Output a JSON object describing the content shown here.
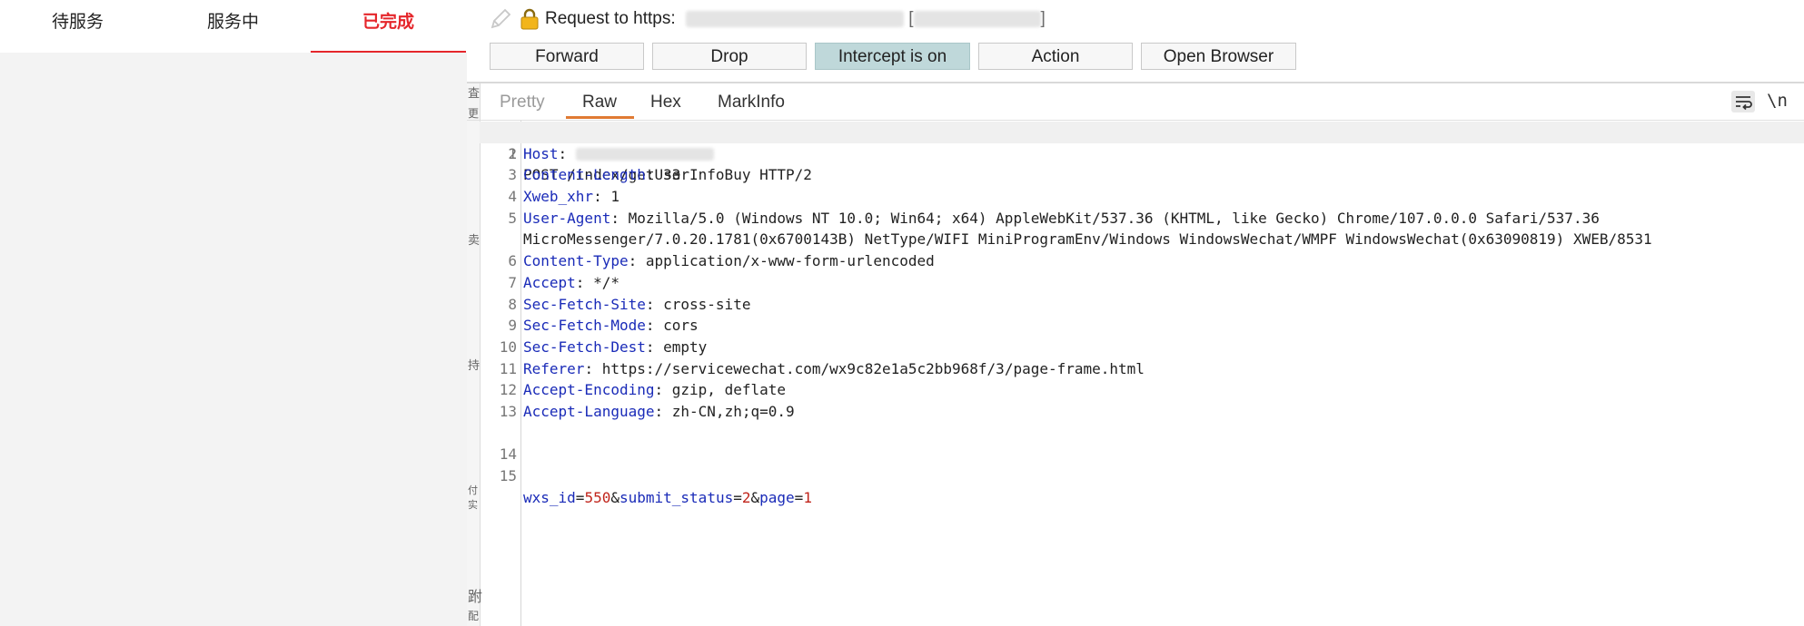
{
  "miniapp": {
    "tabs": [
      {
        "label": "待服务",
        "active": false
      },
      {
        "label": "服务中",
        "active": false
      },
      {
        "label": "已完成",
        "active": true
      }
    ],
    "active_color": "#e5262b"
  },
  "strip_chars": [
    "査",
    "更",
    "卖",
    "持",
    "付实",
    "跗",
    "配"
  ],
  "burp": {
    "request_label": "Request to https:",
    "toolbar": {
      "forward": "Forward",
      "drop": "Drop",
      "intercept": "Intercept is on",
      "action": "Action",
      "open_browser": "Open Browser"
    },
    "subtabs": {
      "pretty": "Pretty",
      "raw": "Raw",
      "hex": "Hex",
      "markinfo": "MarkInfo",
      "newline": "\\n"
    },
    "icons": {
      "pencil": "pencil-icon",
      "lock": "lock-icon",
      "wrap": "word-wrap-icon"
    },
    "request": {
      "line1": "POST /index/getUserInfoBuy HTTP/2",
      "headers": [
        {
          "n": "2",
          "key": "Host",
          "value": ""
        },
        {
          "n": "3",
          "key": "Content-Length",
          "value": ": 33"
        },
        {
          "n": "4",
          "key": "Xweb_xhr",
          "value": ": 1"
        },
        {
          "n": "5",
          "key": "User-Agent",
          "value": ": Mozilla/5.0 (Windows NT 10.0; Win64; x64) AppleWebKit/537.36 (KHTML, like Gecko) Chrome/107.0.0.0 Safari/537.36",
          "cont": "MicroMessenger/7.0.20.1781(0x6700143B) NetType/WIFI MiniProgramEnv/Windows WindowsWechat/WMPF WindowsWechat(0x63090819) XWEB/8531"
        },
        {
          "n": "6",
          "key": "Content-Type",
          "value": ": application/x-www-form-urlencoded"
        },
        {
          "n": "7",
          "key": "Accept",
          "value": ": */*"
        },
        {
          "n": "8",
          "key": "Sec-Fetch-Site",
          "value": ": cross-site"
        },
        {
          "n": "9",
          "key": "Sec-Fetch-Mode",
          "value": ": cors"
        },
        {
          "n": "10",
          "key": "Sec-Fetch-Dest",
          "value": ": empty"
        },
        {
          "n": "11",
          "key": "Referer",
          "value": ": https://servicewechat.com/wx9c82e1a5c2bb968f/3/page-frame.html"
        },
        {
          "n": "12",
          "key": "Accept-Encoding",
          "value": ": gzip, deflate"
        },
        {
          "n": "13",
          "key": "Accept-Language",
          "value": ": zh-CN,zh;q=0.9"
        }
      ],
      "empty_line": "14",
      "body_line": "15",
      "body": [
        {
          "k": "wxs_id",
          "v": "550"
        },
        {
          "k": "submit_status",
          "v": "2"
        },
        {
          "k": "page",
          "v": "1"
        }
      ]
    }
  }
}
